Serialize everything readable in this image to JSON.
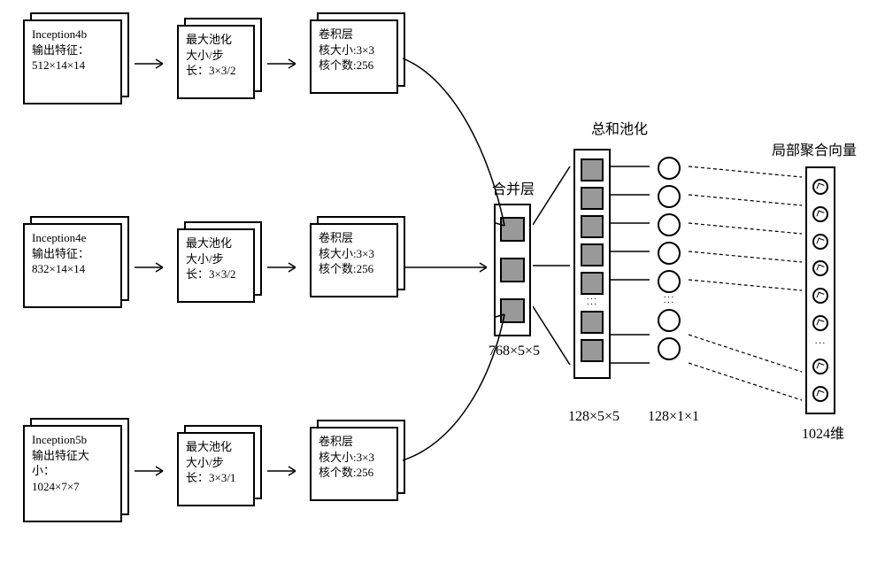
{
  "rows": [
    {
      "inception": {
        "name": "Inception4b",
        "l1": "输出特征：",
        "l2": "512×14×14"
      },
      "pool": {
        "l0": "最大池化",
        "l1": "大小/步",
        "l2": "长：3×3/2"
      },
      "conv": {
        "l0": "卷积层",
        "l1": "核大小:3×3",
        "l2": "核个数:256"
      }
    },
    {
      "inception": {
        "name": "Inception4e",
        "l1": "输出特征：",
        "l2": "832×14×14"
      },
      "pool": {
        "l0": "最大池化",
        "l1": "大小/步",
        "l2": "长：3×3/2"
      },
      "conv": {
        "l0": "卷积层",
        "l1": "核大小:3×3",
        "l2": "核个数:256"
      }
    },
    {
      "inception": {
        "name": "Inception5b",
        "l1": "输出特征大",
        "l2": "小：",
        "l3": "1024×7×7"
      },
      "pool": {
        "l0": "最大池化",
        "l1": "大小/步",
        "l2": "长：3×3/1"
      },
      "conv": {
        "l0": "卷积层",
        "l1": "核大小:3×3",
        "l2": "核个数:256"
      }
    }
  ],
  "labels": {
    "concat": "合并层",
    "concat_dim": "768×5×5",
    "sumpool": "总和池化",
    "sumpool_dim1": "128×5×5",
    "sumpool_dim2": "128×1×1",
    "vec": "局部聚合向量",
    "vec_dim": "1024维"
  }
}
